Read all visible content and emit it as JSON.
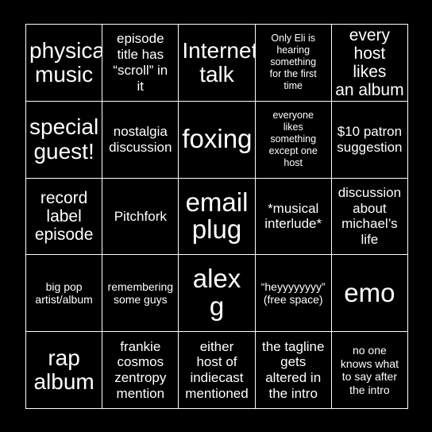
{
  "card": {
    "background_color": "#000000",
    "text_color": "#ffffff",
    "grid_line_color": "#ffffff",
    "columns": 5,
    "rows": 5,
    "cells": [
      {
        "text": "physical\nmusic",
        "size": "xl",
        "name": "cell-r1c1"
      },
      {
        "text": "episode\ntitle has\n“scroll” in\nit",
        "size": "md",
        "name": "cell-r1c2"
      },
      {
        "text": "Internet\ntalk",
        "size": "xl",
        "name": "cell-r1c3"
      },
      {
        "text": "Only Eli is\nhearing\nsomething\nfor the first\ntime",
        "size": "xs",
        "name": "cell-r1c4"
      },
      {
        "text": "every\nhost likes\nan album",
        "size": "lg",
        "name": "cell-r1c5"
      },
      {
        "text": "special\nguest!",
        "size": "xl",
        "name": "cell-r2c1"
      },
      {
        "text": "nostalgia\ndiscussion",
        "size": "md",
        "name": "cell-r2c2"
      },
      {
        "text": "foxing",
        "size": "xxl",
        "name": "cell-r2c3"
      },
      {
        "text": "everyone\nlikes\nsomething\nexcept one\nhost",
        "size": "xs",
        "name": "cell-r2c4"
      },
      {
        "text": "$10 patron\nsuggestion",
        "size": "md",
        "name": "cell-r2c5"
      },
      {
        "text": "record\nlabel\nepisode",
        "size": "lg",
        "name": "cell-r3c1"
      },
      {
        "text": "Pitchfork",
        "size": "md",
        "name": "cell-r3c2"
      },
      {
        "text": "email\nplug",
        "size": "xxl",
        "name": "cell-r3c3"
      },
      {
        "text": "*musical\ninterlude*",
        "size": "md",
        "name": "cell-r3c4"
      },
      {
        "text": "discussion\nabout\nmichael’s\nlife",
        "size": "md",
        "name": "cell-r3c5"
      },
      {
        "text": "big pop\nartist/album",
        "size": "sm",
        "name": "cell-r4c1"
      },
      {
        "text": "remembering\nsome guys",
        "size": "sm",
        "name": "cell-r4c2"
      },
      {
        "text": "alex\ng",
        "size": "xxl",
        "name": "cell-r4c3"
      },
      {
        "text": "“heyyyyyyyy”\n(free space)",
        "size": "sm",
        "name": "cell-r4c4-free-space"
      },
      {
        "text": "emo",
        "size": "xxl",
        "name": "cell-r4c5"
      },
      {
        "text": "rap\nalbum",
        "size": "xl",
        "name": "cell-r5c1"
      },
      {
        "text": "frankie\ncosmos\nzentropy\nmention",
        "size": "md",
        "name": "cell-r5c2"
      },
      {
        "text": "either\nhost of\nindiecast\nmentioned",
        "size": "md",
        "name": "cell-r5c3"
      },
      {
        "text": "the tagline\ngets\naltered in\nthe intro",
        "size": "md",
        "name": "cell-r5c4"
      },
      {
        "text": "no one\nknows what\nto say after\nthe intro",
        "size": "sm",
        "name": "cell-r5c5"
      }
    ]
  }
}
